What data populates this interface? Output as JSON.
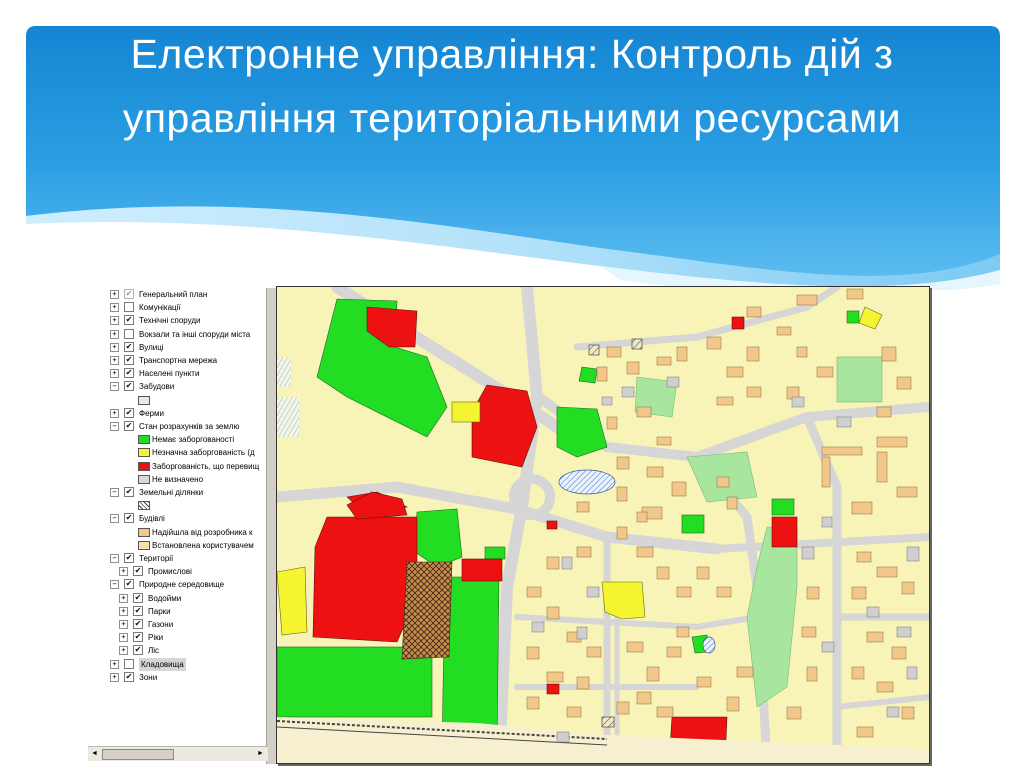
{
  "slide": {
    "title": "Електронне управління: Контроль дій з управління територіальними ресурсами"
  },
  "colors": {
    "banner_blue": "#1a8fd8",
    "banner_light": "#8fd0f6",
    "map_background": "#f8f4b8",
    "road": "#d9d9d9",
    "building": "#f2c78a",
    "no_debt": "#22dd22",
    "minor_debt": "#f4f430",
    "debt": "#ee1111",
    "undefined": "#cfcfcf"
  },
  "toc": {
    "items": [
      {
        "expander": "+",
        "checked": true,
        "dim": true,
        "label": "Генеральний план"
      },
      {
        "expander": "+",
        "checked": false,
        "label": "Комунікації"
      },
      {
        "expander": "+",
        "checked": true,
        "label": "Технічні споруди"
      },
      {
        "expander": "+",
        "checked": false,
        "label": "Вокзали та інші споруди міста"
      },
      {
        "expander": "+",
        "checked": true,
        "label": "Вулиці"
      },
      {
        "expander": "+",
        "checked": true,
        "label": "Транспортна мережа"
      },
      {
        "expander": "+",
        "checked": true,
        "label": "Населені пункти"
      },
      {
        "expander": "−",
        "checked": true,
        "label": "Забудови"
      },
      {
        "swatch": "building-light-swatch",
        "label": ""
      },
      {
        "expander": "+",
        "checked": true,
        "label": "Ферми"
      },
      {
        "expander": "−",
        "checked": true,
        "label": "Стан розрахунків за землю"
      },
      {
        "swatch": "no-debt-swatch",
        "label": "Немає заборгованості"
      },
      {
        "swatch": "minor-debt-swatch",
        "label": "Незначна заборгованість (д"
      },
      {
        "swatch": "debt-swatch",
        "label": "Заборгованість, що перевищ"
      },
      {
        "swatch": "undefined-swatch",
        "label": "Не визначено"
      },
      {
        "expander": "−",
        "checked": true,
        "label": "Земельні ділянки"
      },
      {
        "swatch": "hatch-swatch",
        "label": ""
      },
      {
        "expander": "−",
        "checked": true,
        "label": "Будівлі"
      },
      {
        "swatch": "developer-swatch",
        "label": "Надійшла від розробника к"
      },
      {
        "swatch": "user-swatch",
        "label": "Встановлена користувачем"
      },
      {
        "expander": "−",
        "checked": true,
        "label": "Території"
      },
      {
        "expander": "+",
        "checked": true,
        "indent": 1,
        "label": "Промислові"
      },
      {
        "expander": "−",
        "checked": true,
        "label": "Природне середовище"
      },
      {
        "expander": "+",
        "checked": true,
        "indent": 1,
        "label": "Водойми"
      },
      {
        "expander": "+",
        "checked": true,
        "indent": 1,
        "label": "Парки"
      },
      {
        "expander": "+",
        "checked": true,
        "indent": 1,
        "label": "Газони"
      },
      {
        "expander": "+",
        "checked": true,
        "indent": 1,
        "label": "Ріки"
      },
      {
        "expander": "+",
        "checked": true,
        "indent": 1,
        "label": "Ліс"
      },
      {
        "expander": "+",
        "checked": false,
        "label": "Кладовища",
        "selected": true
      },
      {
        "expander": "+",
        "checked": true,
        "label": "Зони"
      }
    ]
  },
  "scrollbar": {
    "left_arrow": "◄",
    "right_arrow": "►"
  }
}
